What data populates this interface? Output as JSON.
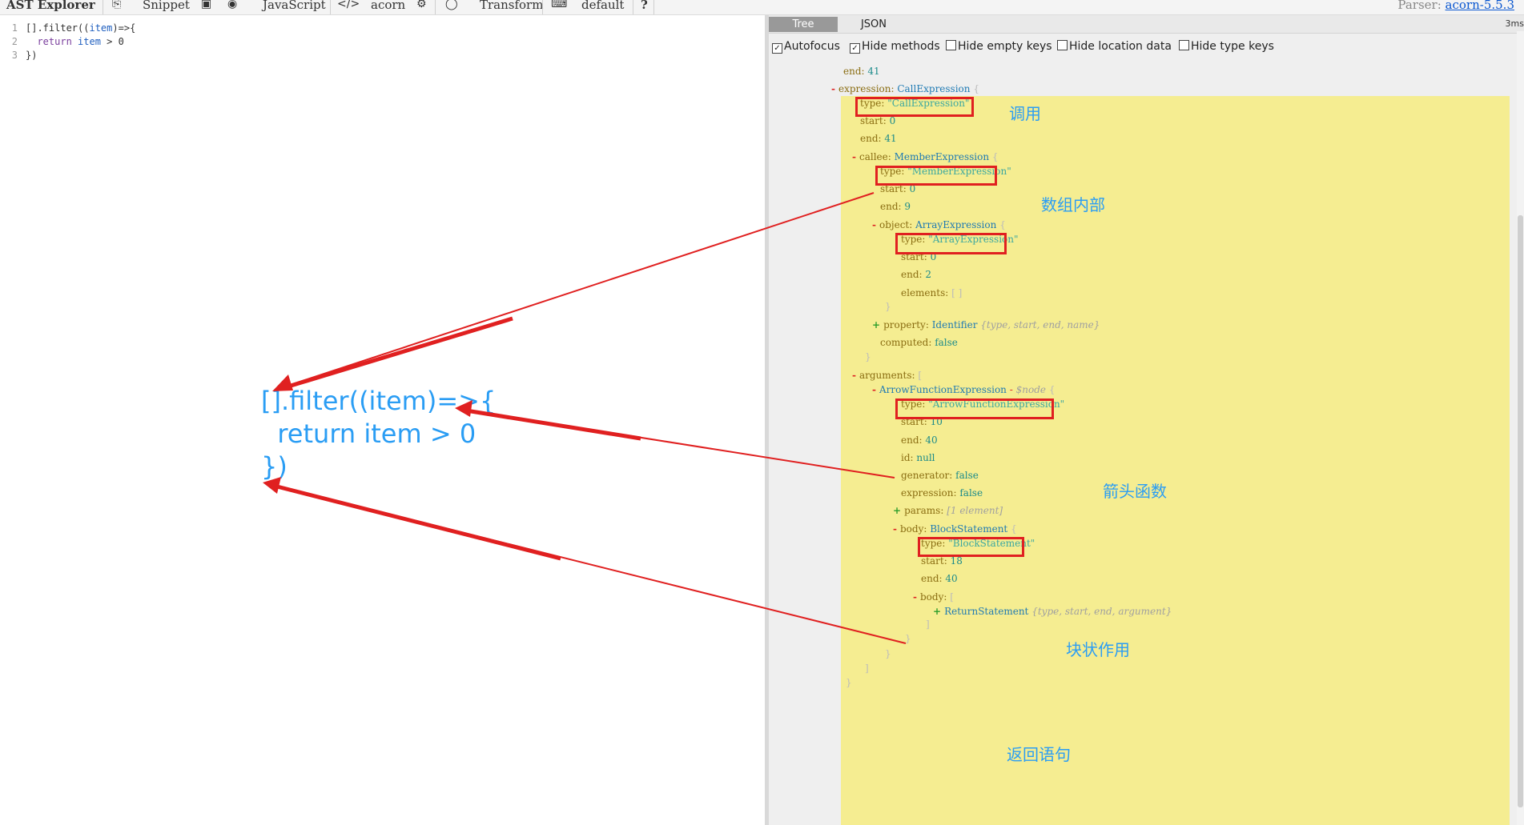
{
  "toolbar": {
    "app_title": "AST Explorer",
    "snippet": "Snippet",
    "language": "JavaScript",
    "parser": "acorn",
    "transform": "Transform",
    "keymap": "default",
    "help": "?",
    "parser_label": "Parser:",
    "parser_version": "acorn-5.5.3"
  },
  "editor": {
    "lines": [
      {
        "no": "1",
        "text": "[].filter((item)=>{"
      },
      {
        "no": "2",
        "text": "  return item > 0"
      },
      {
        "no": "3",
        "text": "})"
      }
    ]
  },
  "panel": {
    "tabs": [
      "Tree",
      "JSON"
    ],
    "time": "3ms",
    "options": [
      {
        "label": "Autofocus",
        "checked": true
      },
      {
        "label": "Hide methods",
        "checked": true
      },
      {
        "label": "Hide empty keys",
        "checked": false
      },
      {
        "label": "Hide location data",
        "checked": false
      },
      {
        "label": "Hide type keys",
        "checked": false
      }
    ]
  },
  "tree": {
    "end_top": "end",
    "end_top_val": "41",
    "expression_key": "expression",
    "expression_type": "CallExpression",
    "call_type_key": "type",
    "call_type_val": "\"CallExpression\"",
    "call_start_key": "start",
    "call_start_val": "0",
    "call_end_key": "end",
    "call_end_val": "41",
    "callee_key": "callee",
    "callee_type": "MemberExpression",
    "member_type_key": "type",
    "member_type_val": "\"MemberExpression\"",
    "member_start_key": "start",
    "member_start_val": "0",
    "member_end_key": "end",
    "member_end_val": "9",
    "object_key": "object",
    "object_type": "ArrayExpression",
    "array_type_key": "type",
    "array_type_val": "\"ArrayExpression\"",
    "array_start_key": "start",
    "array_start_val": "0",
    "array_end_key": "end",
    "array_end_val": "2",
    "elements_key": "elements",
    "elements_val": "[ ]",
    "property_key": "property",
    "property_type": "Identifier",
    "property_summary": "{type, start, end, name}",
    "computed_key": "computed",
    "computed_val": "false",
    "arguments_key": "arguments",
    "arrow_name": "ArrowFunctionExpression",
    "arrow_node": "$node",
    "arrow_type_key": "type",
    "arrow_type_val": "\"ArrowFunctionExpression\"",
    "arrow_start_key": "start",
    "arrow_start_val": "10",
    "arrow_end_key": "end",
    "arrow_end_val": "40",
    "id_key": "id",
    "id_val": "null",
    "generator_key": "generator",
    "generator_val": "false",
    "expression2_key": "expression",
    "expression2_val": "false",
    "params_key": "params",
    "params_summary": "[1 element]",
    "body_key": "body",
    "body_type": "BlockStatement",
    "block_type_key": "type",
    "block_type_val": "\"BlockStatement\"",
    "block_start_key": "start",
    "block_start_val": "18",
    "block_end_key": "end",
    "block_end_val": "40",
    "body2_key": "body",
    "return_type": "ReturnStatement",
    "return_summary": "{type, start, end, argument}"
  },
  "annotations": {
    "call": "调用",
    "member": "数组内部",
    "arrow": "箭头函数",
    "block": "块状作用",
    "return": "返回语句",
    "big_code_line1": "[].filter((item)=>{",
    "big_code_line2": "  return item > 0",
    "big_code_line3": "})"
  },
  "colors": {
    "highlight": "#f5ed91",
    "annotation": "#2a9df4",
    "arrow": "#e02020"
  }
}
